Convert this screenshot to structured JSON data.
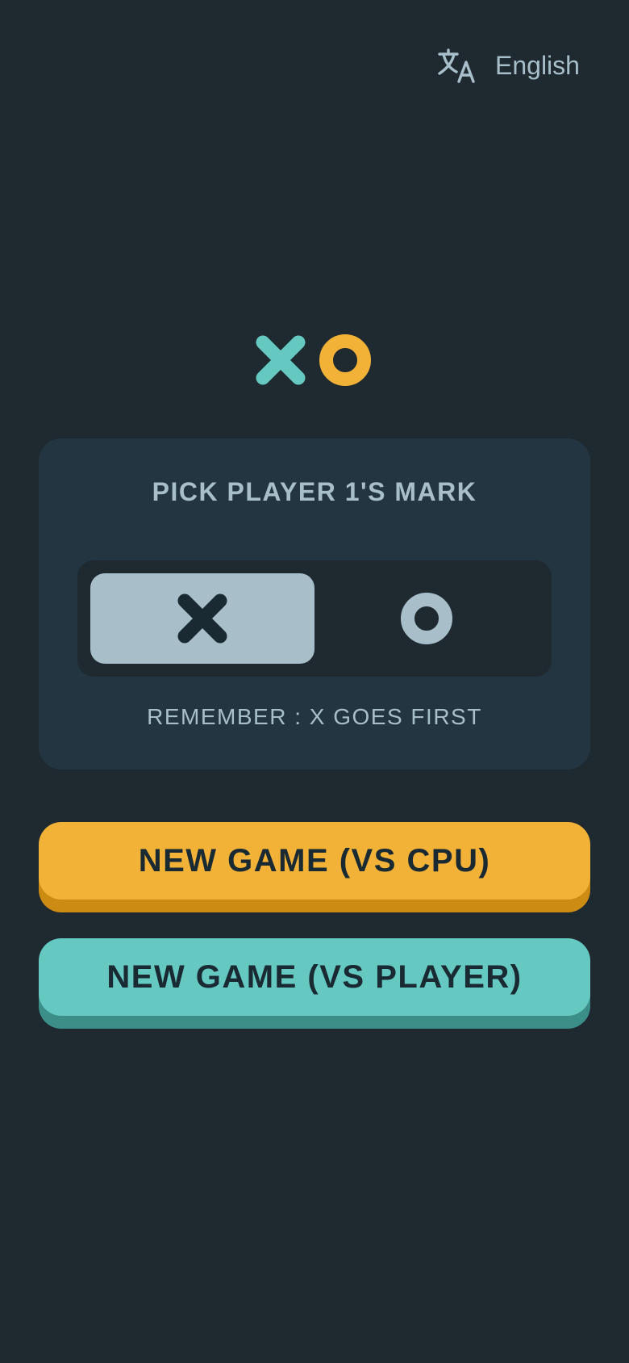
{
  "header": {
    "language_icon": "translate-icon",
    "language_label": "English"
  },
  "logo": {
    "x_icon": "x-mark-icon",
    "o_icon": "o-mark-icon"
  },
  "mark_picker": {
    "title": "PICK PLAYER 1'S MARK",
    "options": [
      {
        "icon": "x-mark-icon",
        "selected": true
      },
      {
        "icon": "o-mark-icon",
        "selected": false
      }
    ],
    "note": "REMEMBER : X GOES FIRST"
  },
  "buttons": {
    "vs_cpu_label": "NEW GAME (VS CPU)",
    "vs_player_label": "NEW GAME (VS PLAYER)"
  },
  "colors": {
    "background": "#1F2930",
    "card": "#233540",
    "silver": "#A8BFC9",
    "yellow": "#F2B137",
    "yellow_shadow": "#CC8B13",
    "teal": "#65C9C2",
    "teal_shadow": "#3C8F89",
    "dark_text": "#1A2A33"
  }
}
